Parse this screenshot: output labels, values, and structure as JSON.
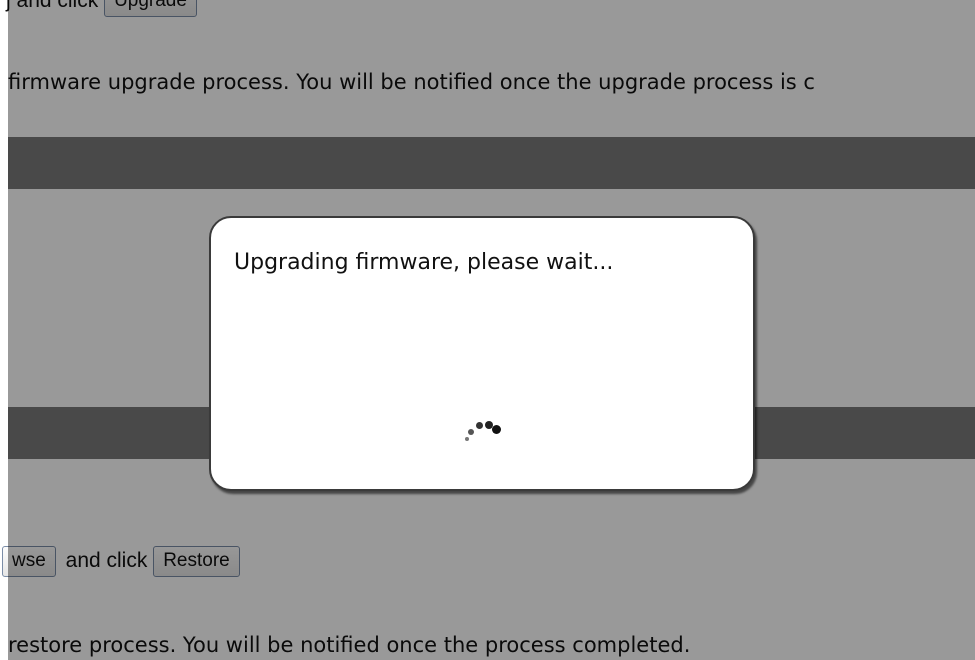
{
  "background_page": {
    "upgrade_instruction_text": "and click",
    "upgrade_button_label": "Upgrade",
    "upgrade_note": "firmware upgrade process. You will be notified once the upgrade process is c",
    "browse_button_label": "wse",
    "restore_instruction_text": "and click",
    "restore_button_label": "Restore",
    "restore_note": "restore process. You will be notified once the process completed.",
    "cut_prefix": "j"
  },
  "modal": {
    "message": "Upgrading firmware, please wait...",
    "spinner_icon": "loading-spinner-icon"
  },
  "colors": {
    "overlay": "#000000",
    "band": "#444444",
    "modal_border": "#3a3a3a"
  }
}
